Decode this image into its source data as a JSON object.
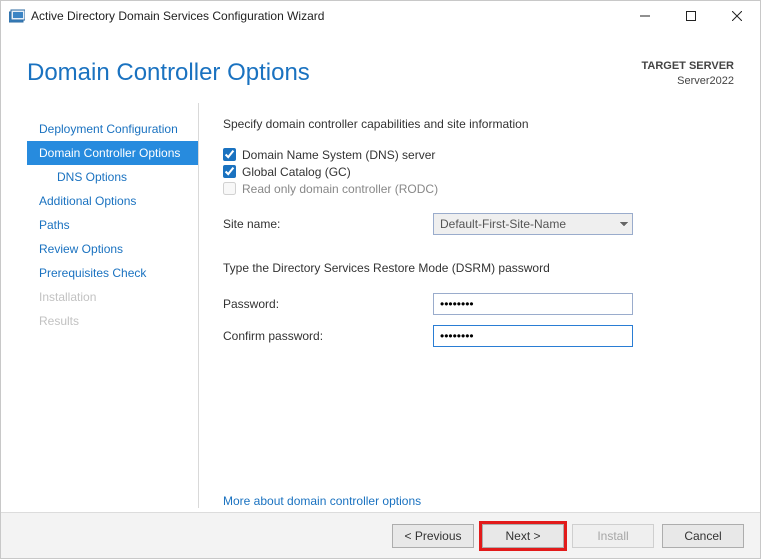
{
  "window": {
    "title": "Active Directory Domain Services Configuration Wizard"
  },
  "header": {
    "title": "Domain Controller Options",
    "target_label": "TARGET SERVER",
    "target_value": "Server2022"
  },
  "nav": {
    "items": [
      {
        "label": "Deployment Configuration"
      },
      {
        "label": "Domain Controller Options",
        "active": true
      },
      {
        "label": "DNS Options",
        "sub": true
      },
      {
        "label": "Additional Options"
      },
      {
        "label": "Paths"
      },
      {
        "label": "Review Options"
      },
      {
        "label": "Prerequisites Check"
      },
      {
        "label": "Installation",
        "disabled": true
      },
      {
        "label": "Results",
        "disabled": true
      }
    ]
  },
  "content": {
    "intro": "Specify domain controller capabilities and site information",
    "checks": [
      {
        "label": "Domain Name System (DNS) server",
        "checked": true
      },
      {
        "label": "Global Catalog (GC)",
        "checked": true
      },
      {
        "label": "Read only domain controller (RODC)",
        "checked": false,
        "disabled": true
      }
    ],
    "site_label": "Site name:",
    "site_value": "Default-First-Site-Name",
    "dsrm_heading": "Type the Directory Services Restore Mode (DSRM) password",
    "password_label": "Password:",
    "password_value": "••••••••",
    "confirm_label": "Confirm password:",
    "confirm_value": "••••••••",
    "more_link": "More about domain controller options"
  },
  "footer": {
    "previous": "< Previous",
    "next": "Next >",
    "install": "Install",
    "cancel": "Cancel"
  }
}
